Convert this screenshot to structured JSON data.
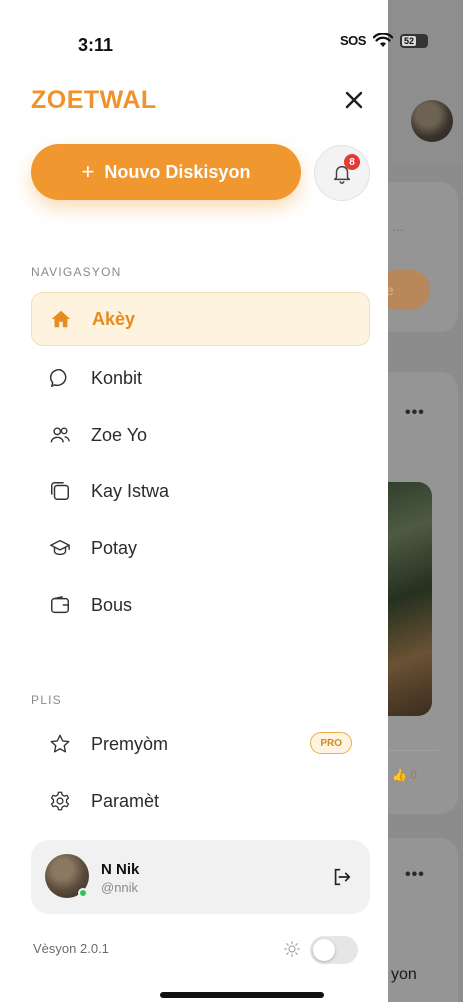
{
  "status_bar": {
    "time": "3:11",
    "sos": "SOS",
    "battery": "52"
  },
  "drawer": {
    "brand": "ZOETWAL",
    "new_discussion_label": "Nouvo Diskisyon",
    "notification_count": "8",
    "nav_section_label": "NAVIGASYON",
    "nav_items": [
      {
        "label": "Akèy",
        "icon": "home-icon",
        "active": true
      },
      {
        "label": "Konbit",
        "icon": "chat-bubble-icon"
      },
      {
        "label": "Zoe Yo",
        "icon": "people-icon"
      },
      {
        "label": "Kay Istwa",
        "icon": "layers-icon"
      },
      {
        "label": "Potay",
        "icon": "graduation-cap-icon"
      },
      {
        "label": "Bous",
        "icon": "wallet-icon"
      }
    ],
    "more_section_label": "PLIS",
    "more_items": [
      {
        "label": "Premyòm",
        "icon": "star-icon",
        "badge": "PRO"
      },
      {
        "label": "Paramèt",
        "icon": "gear-icon"
      }
    ],
    "user": {
      "name": "N Nik",
      "handle": "@nnik",
      "online": true
    },
    "version": "Vèsyon 2.0.1",
    "dark_mode_on": false
  },
  "background": {
    "snippet_text": "yon",
    "pill_text": "te",
    "like_count": "0"
  },
  "colors": {
    "accent": "#f0972f",
    "active_bg": "#fdf3df",
    "badge": "#e53935",
    "online": "#33c05a"
  }
}
